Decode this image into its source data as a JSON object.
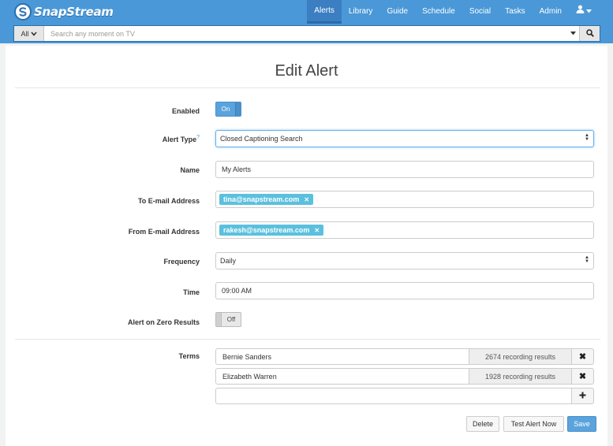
{
  "brand": {
    "name": "SnapStream"
  },
  "nav": {
    "items": [
      "Alerts",
      "Library",
      "Guide",
      "Schedule",
      "Social",
      "Tasks",
      "Admin"
    ],
    "active": "Alerts"
  },
  "search": {
    "scope_label": "All",
    "placeholder": "Search any moment on TV",
    "value": ""
  },
  "page": {
    "title": "Edit Alert"
  },
  "form": {
    "enabled": {
      "label": "Enabled",
      "state": "On"
    },
    "alert_type": {
      "label": "Alert Type",
      "help_marker": "?",
      "value": "Closed Captioning Search"
    },
    "name": {
      "label": "Name",
      "value": "My Alerts"
    },
    "to_email": {
      "label": "To E-mail Address",
      "tags": [
        "tina@snapstream.com"
      ]
    },
    "from_email": {
      "label": "From E-mail Address",
      "tags": [
        "rakesh@snapstream.com"
      ]
    },
    "frequency": {
      "label": "Frequency",
      "value": "Daily"
    },
    "time": {
      "label": "Time",
      "value": "09:00 AM"
    },
    "zero_results": {
      "label": "Alert on Zero Results",
      "state": "Off"
    },
    "terms": {
      "label": "Terms",
      "rows": [
        {
          "term": "Bernie Sanders",
          "count": "2674 recording results"
        },
        {
          "term": "Elizabeth Warren",
          "count": "1928 recording results"
        }
      ],
      "new_value": ""
    }
  },
  "actions": {
    "delete": "Delete",
    "test": "Test Alert Now",
    "save": "Save"
  },
  "colors": {
    "navbar": "#4a98d7",
    "nav_active": "#3b7fc2",
    "toggle_on": "#5aa3dd",
    "tag": "#5bc0de",
    "save_button": "#5aa3dd"
  },
  "icons": {
    "logo": "snapstream-logo-icon",
    "user": "user-icon",
    "dropdown": "caret-down-icon",
    "search": "search-icon",
    "remove": "times-icon",
    "add": "plus-icon"
  }
}
